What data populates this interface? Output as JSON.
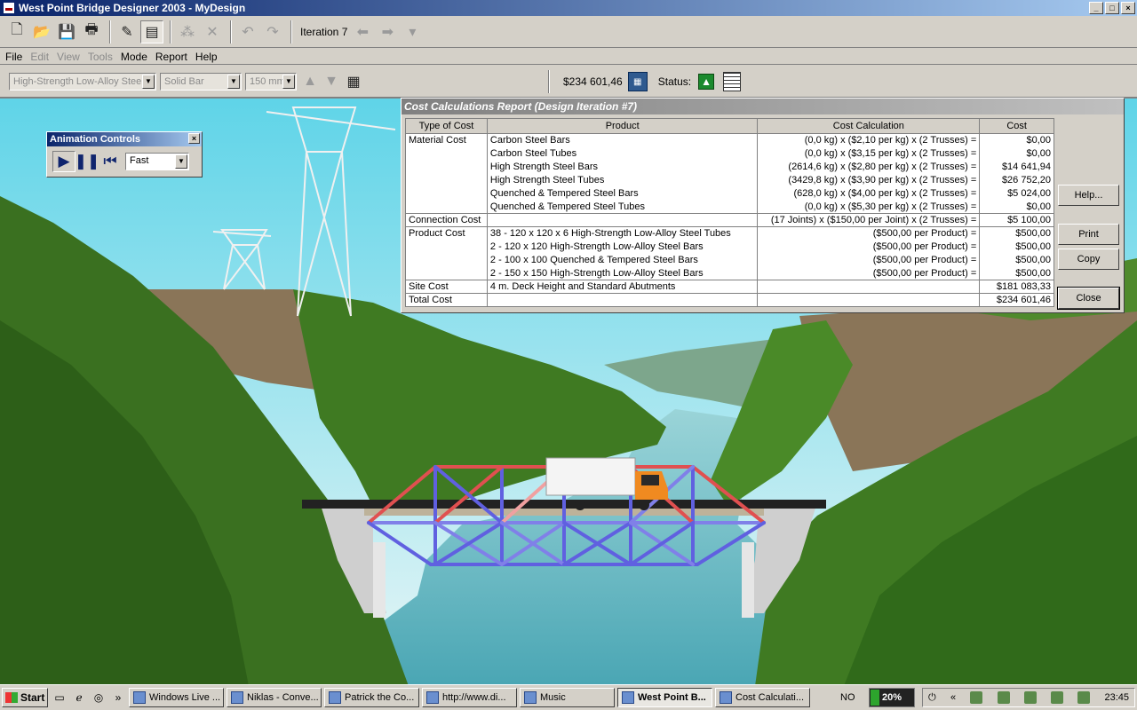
{
  "window": {
    "title": "West Point Bridge Designer 2003 - MyDesign"
  },
  "toolbar": {
    "iteration_label": "Iteration 7",
    "icons": [
      "new-file-icon",
      "open-folder-icon",
      "save-icon",
      "print-icon",
      "draw-joints-icon",
      "draw-members-icon",
      "auto-correct-icon",
      "delete-icon",
      "undo-icon",
      "redo-icon",
      "back-arrow-icon",
      "forward-arrow-icon",
      "dropdown-icon"
    ]
  },
  "menu": {
    "items": [
      {
        "label": "File",
        "enabled": true
      },
      {
        "label": "Edit",
        "enabled": false
      },
      {
        "label": "View",
        "enabled": false
      },
      {
        "label": "Tools",
        "enabled": false
      },
      {
        "label": "Mode",
        "enabled": true
      },
      {
        "label": "Report",
        "enabled": true
      },
      {
        "label": "Help",
        "enabled": true
      }
    ]
  },
  "member_props": {
    "material": "High-Strength Low-Alloy Steel",
    "cross_section": "Solid Bar",
    "size": "150 mm"
  },
  "cost": {
    "value": "$234 601,46"
  },
  "status": {
    "label": "Status:"
  },
  "animation": {
    "title": "Animation Controls",
    "speed": "Fast"
  },
  "report": {
    "title": "Cost Calculations Report (Design Iteration #7)",
    "headers": [
      "Type of Cost",
      "Product",
      "Cost Calculation",
      "Cost"
    ],
    "rows": [
      {
        "type": "Material Cost",
        "product": "Carbon Steel Bars",
        "calc": "(0,0 kg) x ($2,10 per kg) x (2 Trusses) =",
        "cost": "$0,00"
      },
      {
        "type": "",
        "product": "Carbon Steel Tubes",
        "calc": "(0,0 kg) x ($3,15 per kg) x (2 Trusses) =",
        "cost": "$0,00"
      },
      {
        "type": "",
        "product": "High Strength Steel Bars",
        "calc": "(2614,6 kg) x ($2,80 per kg) x (2 Trusses) =",
        "cost": "$14 641,94"
      },
      {
        "type": "",
        "product": "High Strength Steel Tubes",
        "calc": "(3429,8 kg) x ($3,90 per kg) x (2 Trusses) =",
        "cost": "$26 752,20"
      },
      {
        "type": "",
        "product": "Quenched & Tempered Steel Bars",
        "calc": "(628,0 kg) x ($4,00 per kg) x (2 Trusses) =",
        "cost": "$5 024,00"
      },
      {
        "type": "",
        "product": "Quenched & Tempered Steel Tubes",
        "calc": "(0,0 kg) x ($5,30 per kg) x (2 Trusses) =",
        "cost": "$0,00"
      },
      {
        "type": "Connection Cost",
        "product": "",
        "calc": "(17 Joints) x ($150,00 per Joint) x (2 Trusses) =",
        "cost": "$5 100,00"
      },
      {
        "type": "Product Cost",
        "product": "38 - 120 x 120 x 6 High-Strength Low-Alloy Steel Tubes",
        "calc": "($500,00 per Product) =",
        "cost": "$500,00"
      },
      {
        "type": "",
        "product": "2 - 120 x 120 High-Strength Low-Alloy Steel Bars",
        "calc": "($500,00 per Product) =",
        "cost": "$500,00"
      },
      {
        "type": "",
        "product": "2 - 100 x 100 Quenched & Tempered Steel Bars",
        "calc": "($500,00 per Product) =",
        "cost": "$500,00"
      },
      {
        "type": "",
        "product": "2 - 150 x 150 High-Strength Low-Alloy Steel Bars",
        "calc": "($500,00 per Product) =",
        "cost": "$500,00"
      },
      {
        "type": "Site Cost",
        "product": "4 m. Deck Height and Standard Abutments",
        "calc": "",
        "cost": "$181 083,33"
      },
      {
        "type": "Total Cost",
        "product": "",
        "calc": "",
        "cost": "$234 601,46"
      }
    ],
    "buttons": {
      "help": "Help...",
      "print": "Print",
      "copy": "Copy",
      "close": "Close"
    }
  },
  "taskbar": {
    "start": "Start",
    "tasks": [
      {
        "label": "Windows Live ...",
        "active": false
      },
      {
        "label": "Niklas - Conve...",
        "active": false
      },
      {
        "label": "Patrick the Co...",
        "active": false
      },
      {
        "label": "http://www.di...",
        "active": false
      },
      {
        "label": "Music",
        "active": false
      },
      {
        "label": "West Point B...",
        "active": true
      },
      {
        "label": "Cost Calculati...",
        "active": false
      }
    ],
    "language": "NO",
    "cpu": "20%",
    "cpu_fraction": 0.2,
    "clock": "23:45"
  },
  "colors": {
    "title_active": "#0a246a",
    "sky": "#bfe8f0",
    "hills": "#3f7a22",
    "river": "#5fb8c4",
    "member_compression": "#e05050",
    "member_tension": "#6060e0"
  }
}
